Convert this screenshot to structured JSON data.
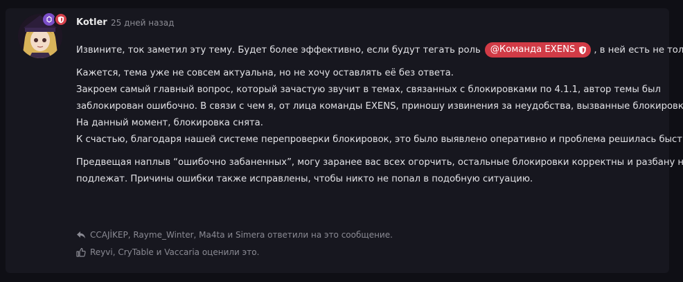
{
  "post": {
    "author": "Kotler",
    "time": "25 дней назад",
    "paragraph1_before": "Извините, ток заметил эту тему. Будет более эффективно, если будут тегать роль",
    "mention": "@Команда EXENS",
    "paragraph1_after": ", в ней есть не только я.",
    "lines2": [
      "Кажется, тема уже не совсем актуальна, но не хочу оставлять её без ответа.",
      "Закроем самый главный вопрос, который зачастую звучит в темах, связанных с блокировками по 4.1.1, автор темы был",
      "заблокирован ошибочно. В связи с чем я, от лица команды EXENS, приношу извинения за неудобства, вызванные блокировкой.",
      "На данный момент, блокировка снята.",
      "К счастью, благодаря нашей системе перепроверки блокировок, это было выявлено оперативно и проблема решилась быстро."
    ],
    "lines3": [
      "Предвещая наплыв “ошибочно забаненных”, могу заранее вас всех огорчить, остальные блокировки корректны и разбану не",
      "подлежат. Причины ошибки также исправлены, чтобы никто не попал в подобную ситуацию."
    ]
  },
  "footer": {
    "replies": "CCAJİKEP, Rayme_Winter, Ma4ta и Simera ответили на это сообщение.",
    "reactions": "Reyvi, CryTable и Vaccaria оценили это."
  },
  "colors": {
    "background": "#0f0f15",
    "card": "#17171f",
    "mention": "#d13b46",
    "badge_purple": "#7b4fc9",
    "badge_red": "#d4404a"
  },
  "icons": {
    "badge1": "staff-icon",
    "badge2": "shield-icon",
    "mention": "shield-icon",
    "replies": "reply-icon",
    "reactions": "thumbs-up-icon"
  }
}
